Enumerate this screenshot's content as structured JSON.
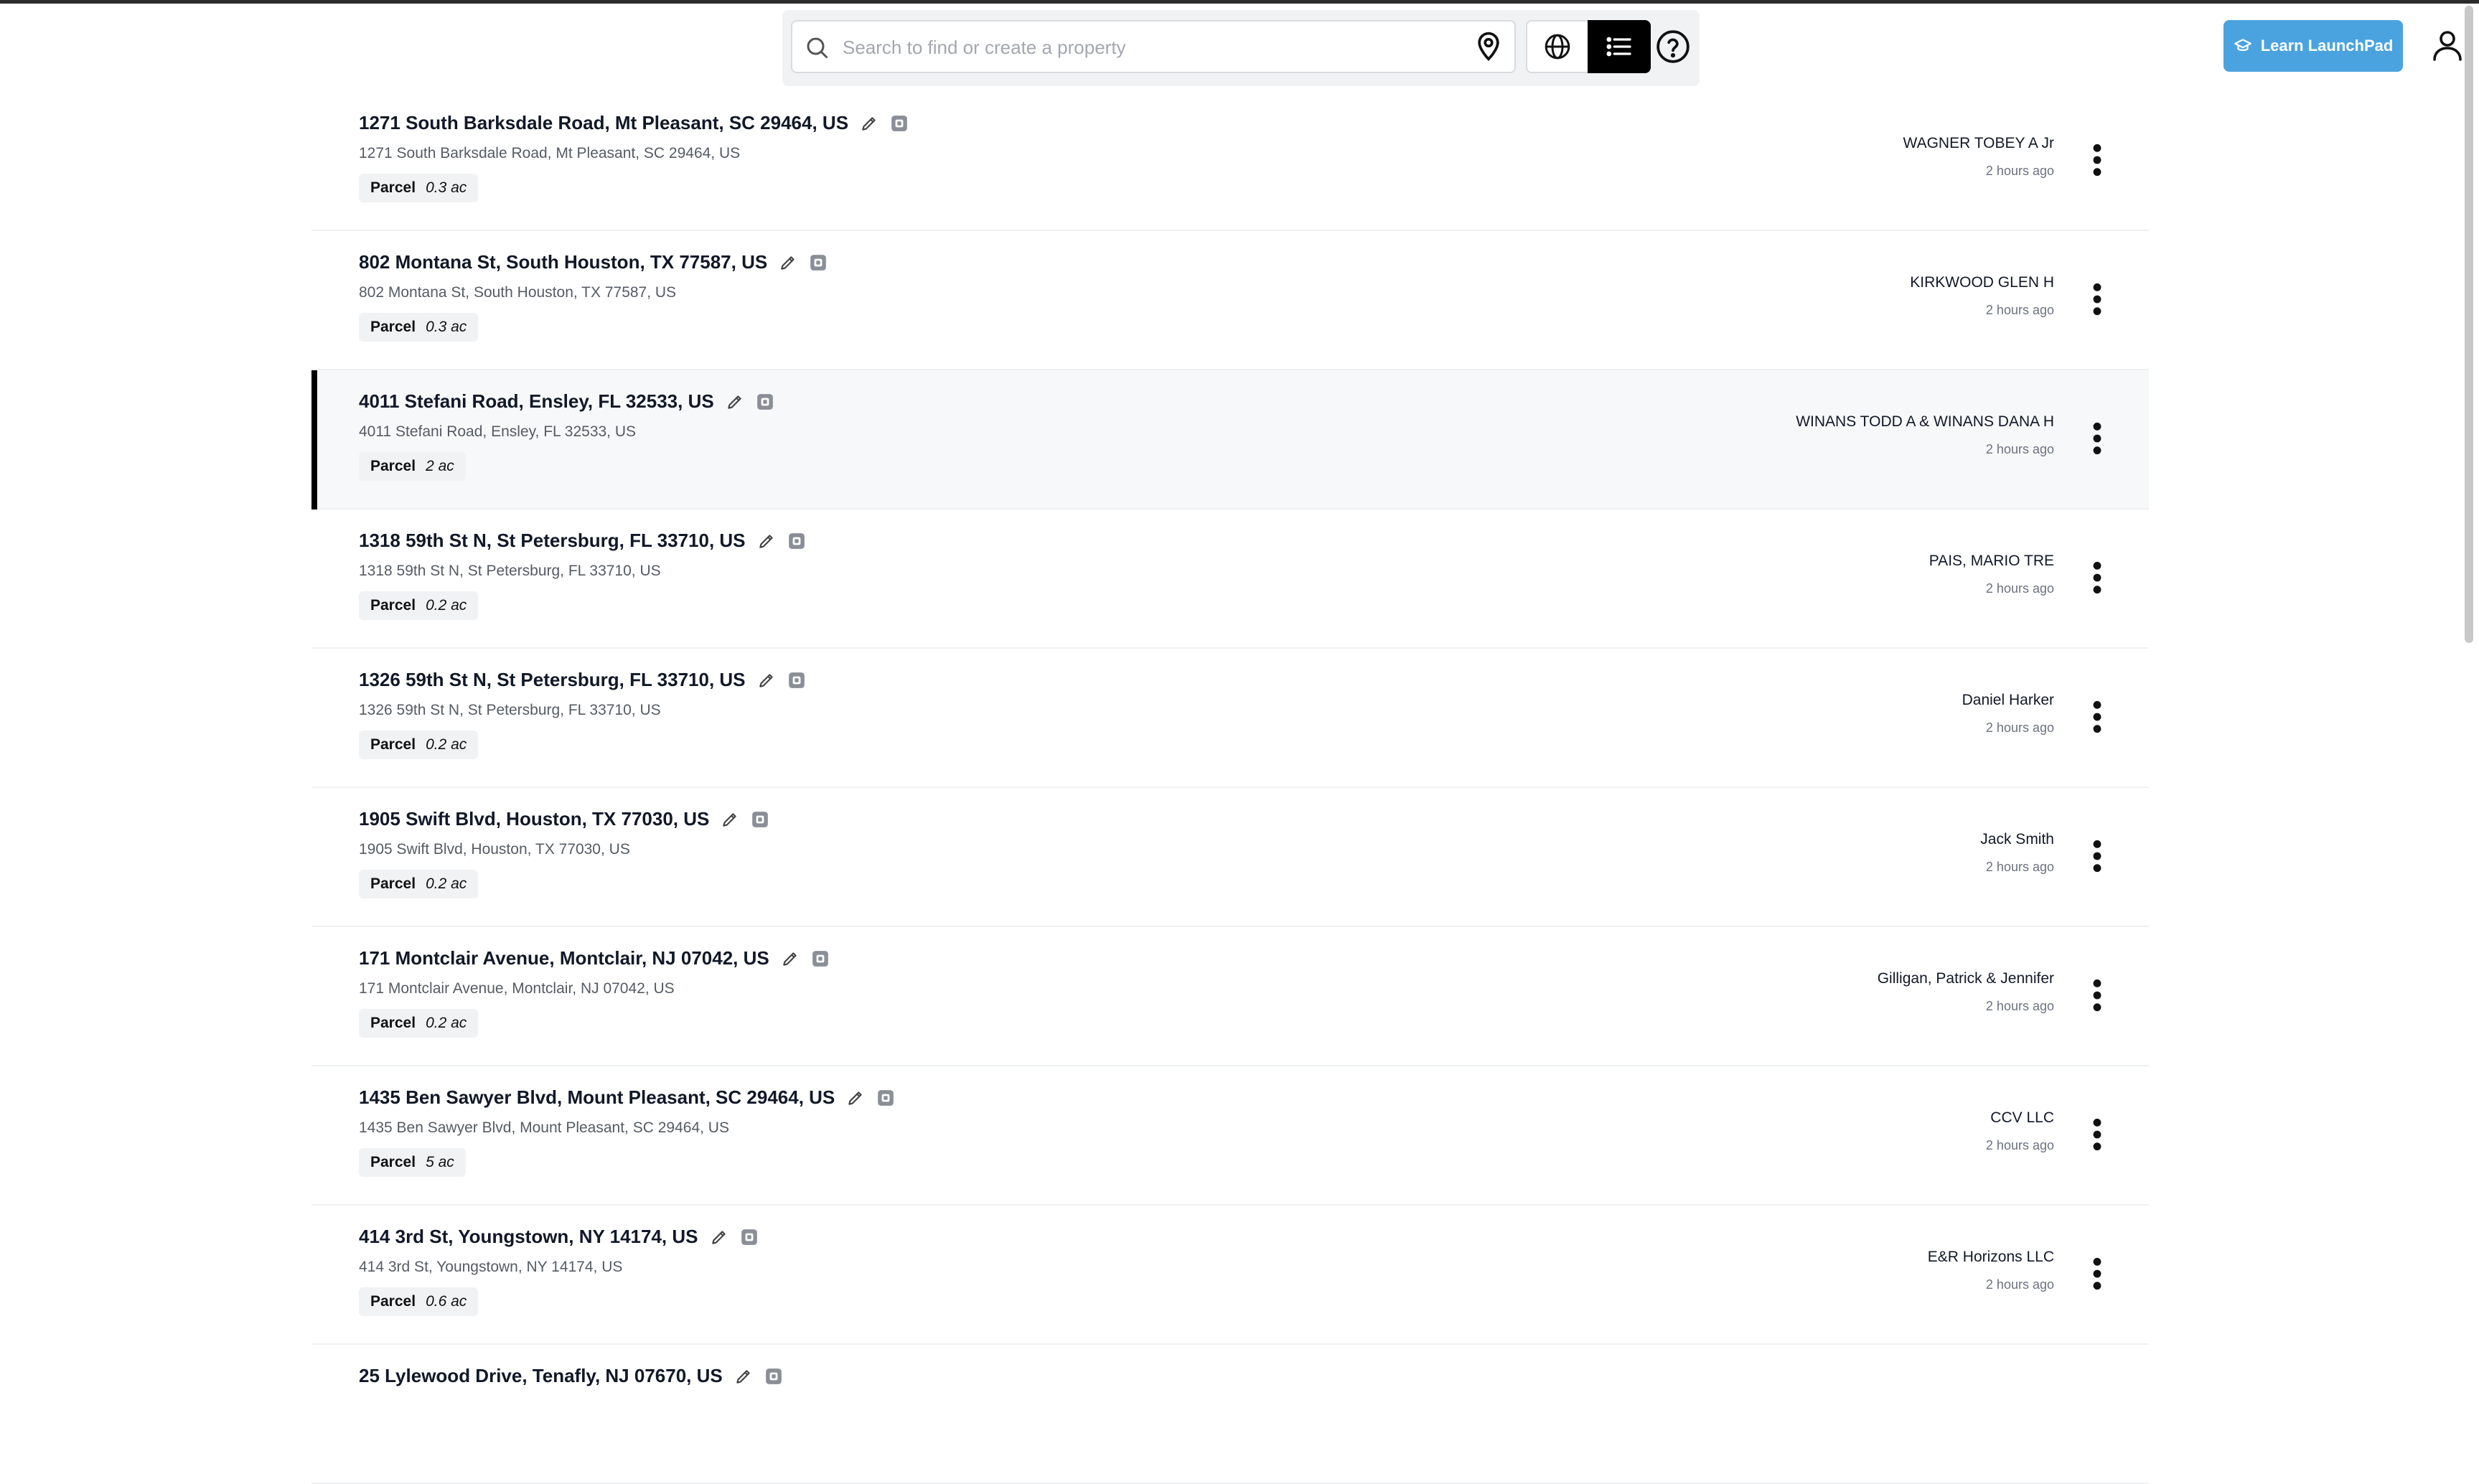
{
  "search": {
    "placeholder": "Search to find or create a property"
  },
  "header": {
    "learn_label": "Learn LaunchPad"
  },
  "colors": {
    "accent": "#4aa3df",
    "active_view": "#000000",
    "selected_marker": "#000000"
  },
  "icons": {
    "search": "search-icon",
    "pin": "map-pin-icon",
    "globe": "globe-icon",
    "list": "list-icon",
    "help": "help-icon",
    "user": "user-icon",
    "edit": "pencil-icon",
    "tag": "tag-icon",
    "more": "more-vertical-icon",
    "learn": "graduation-cap-icon"
  },
  "properties": [
    {
      "title": "1271 South Barksdale Road, Mt Pleasant, SC 29464, US",
      "address": "1271 South Barksdale Road, Mt Pleasant, SC 29464, US",
      "type": "Parcel",
      "area": "0.3 ac",
      "owner": "WAGNER TOBEY A Jr",
      "updated": "2 hours ago",
      "selected": false
    },
    {
      "title": "802 Montana St, South Houston, TX 77587, US",
      "address": "802 Montana St, South Houston, TX 77587, US",
      "type": "Parcel",
      "area": "0.3 ac",
      "owner": "KIRKWOOD GLEN H",
      "updated": "2 hours ago",
      "selected": false
    },
    {
      "title": "4011 Stefani Road, Ensley, FL 32533, US",
      "address": "4011 Stefani Road, Ensley, FL 32533, US",
      "type": "Parcel",
      "area": "2 ac",
      "owner": "WINANS TODD A & WINANS DANA H",
      "updated": "2 hours ago",
      "selected": true
    },
    {
      "title": "1318 59th St N, St Petersburg, FL 33710, US",
      "address": "1318 59th St N, St Petersburg, FL 33710, US",
      "type": "Parcel",
      "area": "0.2 ac",
      "owner": "PAIS, MARIO TRE",
      "updated": "2 hours ago",
      "selected": false
    },
    {
      "title": "1326 59th St N, St Petersburg, FL 33710, US",
      "address": "1326 59th St N, St Petersburg, FL 33710, US",
      "type": "Parcel",
      "area": "0.2 ac",
      "owner": "Daniel Harker",
      "updated": "2 hours ago",
      "selected": false
    },
    {
      "title": "1905 Swift Blvd, Houston, TX 77030, US",
      "address": "1905 Swift Blvd, Houston, TX 77030, US",
      "type": "Parcel",
      "area": "0.2 ac",
      "owner": "Jack Smith",
      "updated": "2 hours ago",
      "selected": false
    },
    {
      "title": "171 Montclair Avenue, Montclair, NJ 07042, US",
      "address": "171 Montclair Avenue, Montclair, NJ 07042, US",
      "type": "Parcel",
      "area": "0.2 ac",
      "owner": "Gilligan, Patrick & Jennifer",
      "updated": "2 hours ago",
      "selected": false
    },
    {
      "title": "1435 Ben Sawyer Blvd, Mount Pleasant, SC 29464, US",
      "address": "1435 Ben Sawyer Blvd, Mount Pleasant, SC 29464, US",
      "type": "Parcel",
      "area": "5 ac",
      "owner": "CCV LLC",
      "updated": "2 hours ago",
      "selected": false
    },
    {
      "title": "414 3rd St, Youngstown, NY 14174, US",
      "address": "414 3rd St, Youngstown, NY 14174, US",
      "type": "Parcel",
      "area": "0.6 ac",
      "owner": "E&R Horizons LLC",
      "updated": "2 hours ago",
      "selected": false
    },
    {
      "title": "25 Lylewood Drive, Tenafly, NJ 07670, US",
      "address": "",
      "type": "",
      "area": "",
      "owner": "",
      "updated": "",
      "selected": false
    }
  ]
}
